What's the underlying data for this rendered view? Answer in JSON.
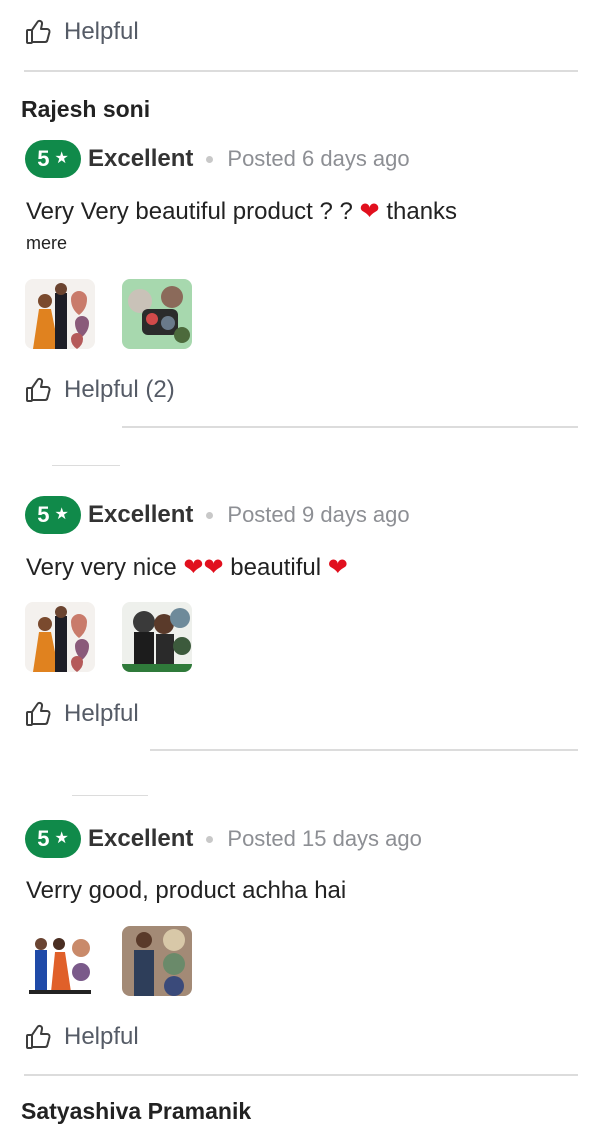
{
  "helpful_top": {
    "label": "Helpful"
  },
  "reviews": [
    {
      "reviewer": "Rajesh soni",
      "rating": "5",
      "rating_label": "Excellent",
      "posted": "Posted 6 days ago",
      "text_line1": "Very Very beautiful product ? ?",
      "text_line1_end": " thanks",
      "text_line2": "mere",
      "helpful_label": "Helpful (2)",
      "images": [
        "photo-couple-heart-collage",
        "photo-green-collage"
      ]
    },
    {
      "reviewer": "",
      "rating": "5",
      "rating_label": "Excellent",
      "posted": "Posted 9 days ago",
      "text_before_hearts": "Very very nice",
      "text_after_hearts": " beautiful",
      "helpful_label": "Helpful",
      "images": [
        "photo-couple-heart-collage",
        "photo-couple-circle-collage"
      ]
    },
    {
      "reviewer": "",
      "rating": "5",
      "rating_label": "Excellent",
      "posted": "Posted 15 days ago",
      "text": "Verry good, product achha hai",
      "helpful_label": "Helpful",
      "images": [
        "photo-couple-standing",
        "photo-man-circle-collage"
      ]
    }
  ],
  "next_reviewer": "Satyashiva Pramanik",
  "icons": {
    "helpful": "thumbs-up-icon",
    "star": "star-icon",
    "heart": "red-heart-emoji"
  },
  "colors": {
    "badge": "#108a4a",
    "heart": "#e1101e",
    "muted_text": "#8d8f94",
    "divider": "#dcdcdc"
  }
}
